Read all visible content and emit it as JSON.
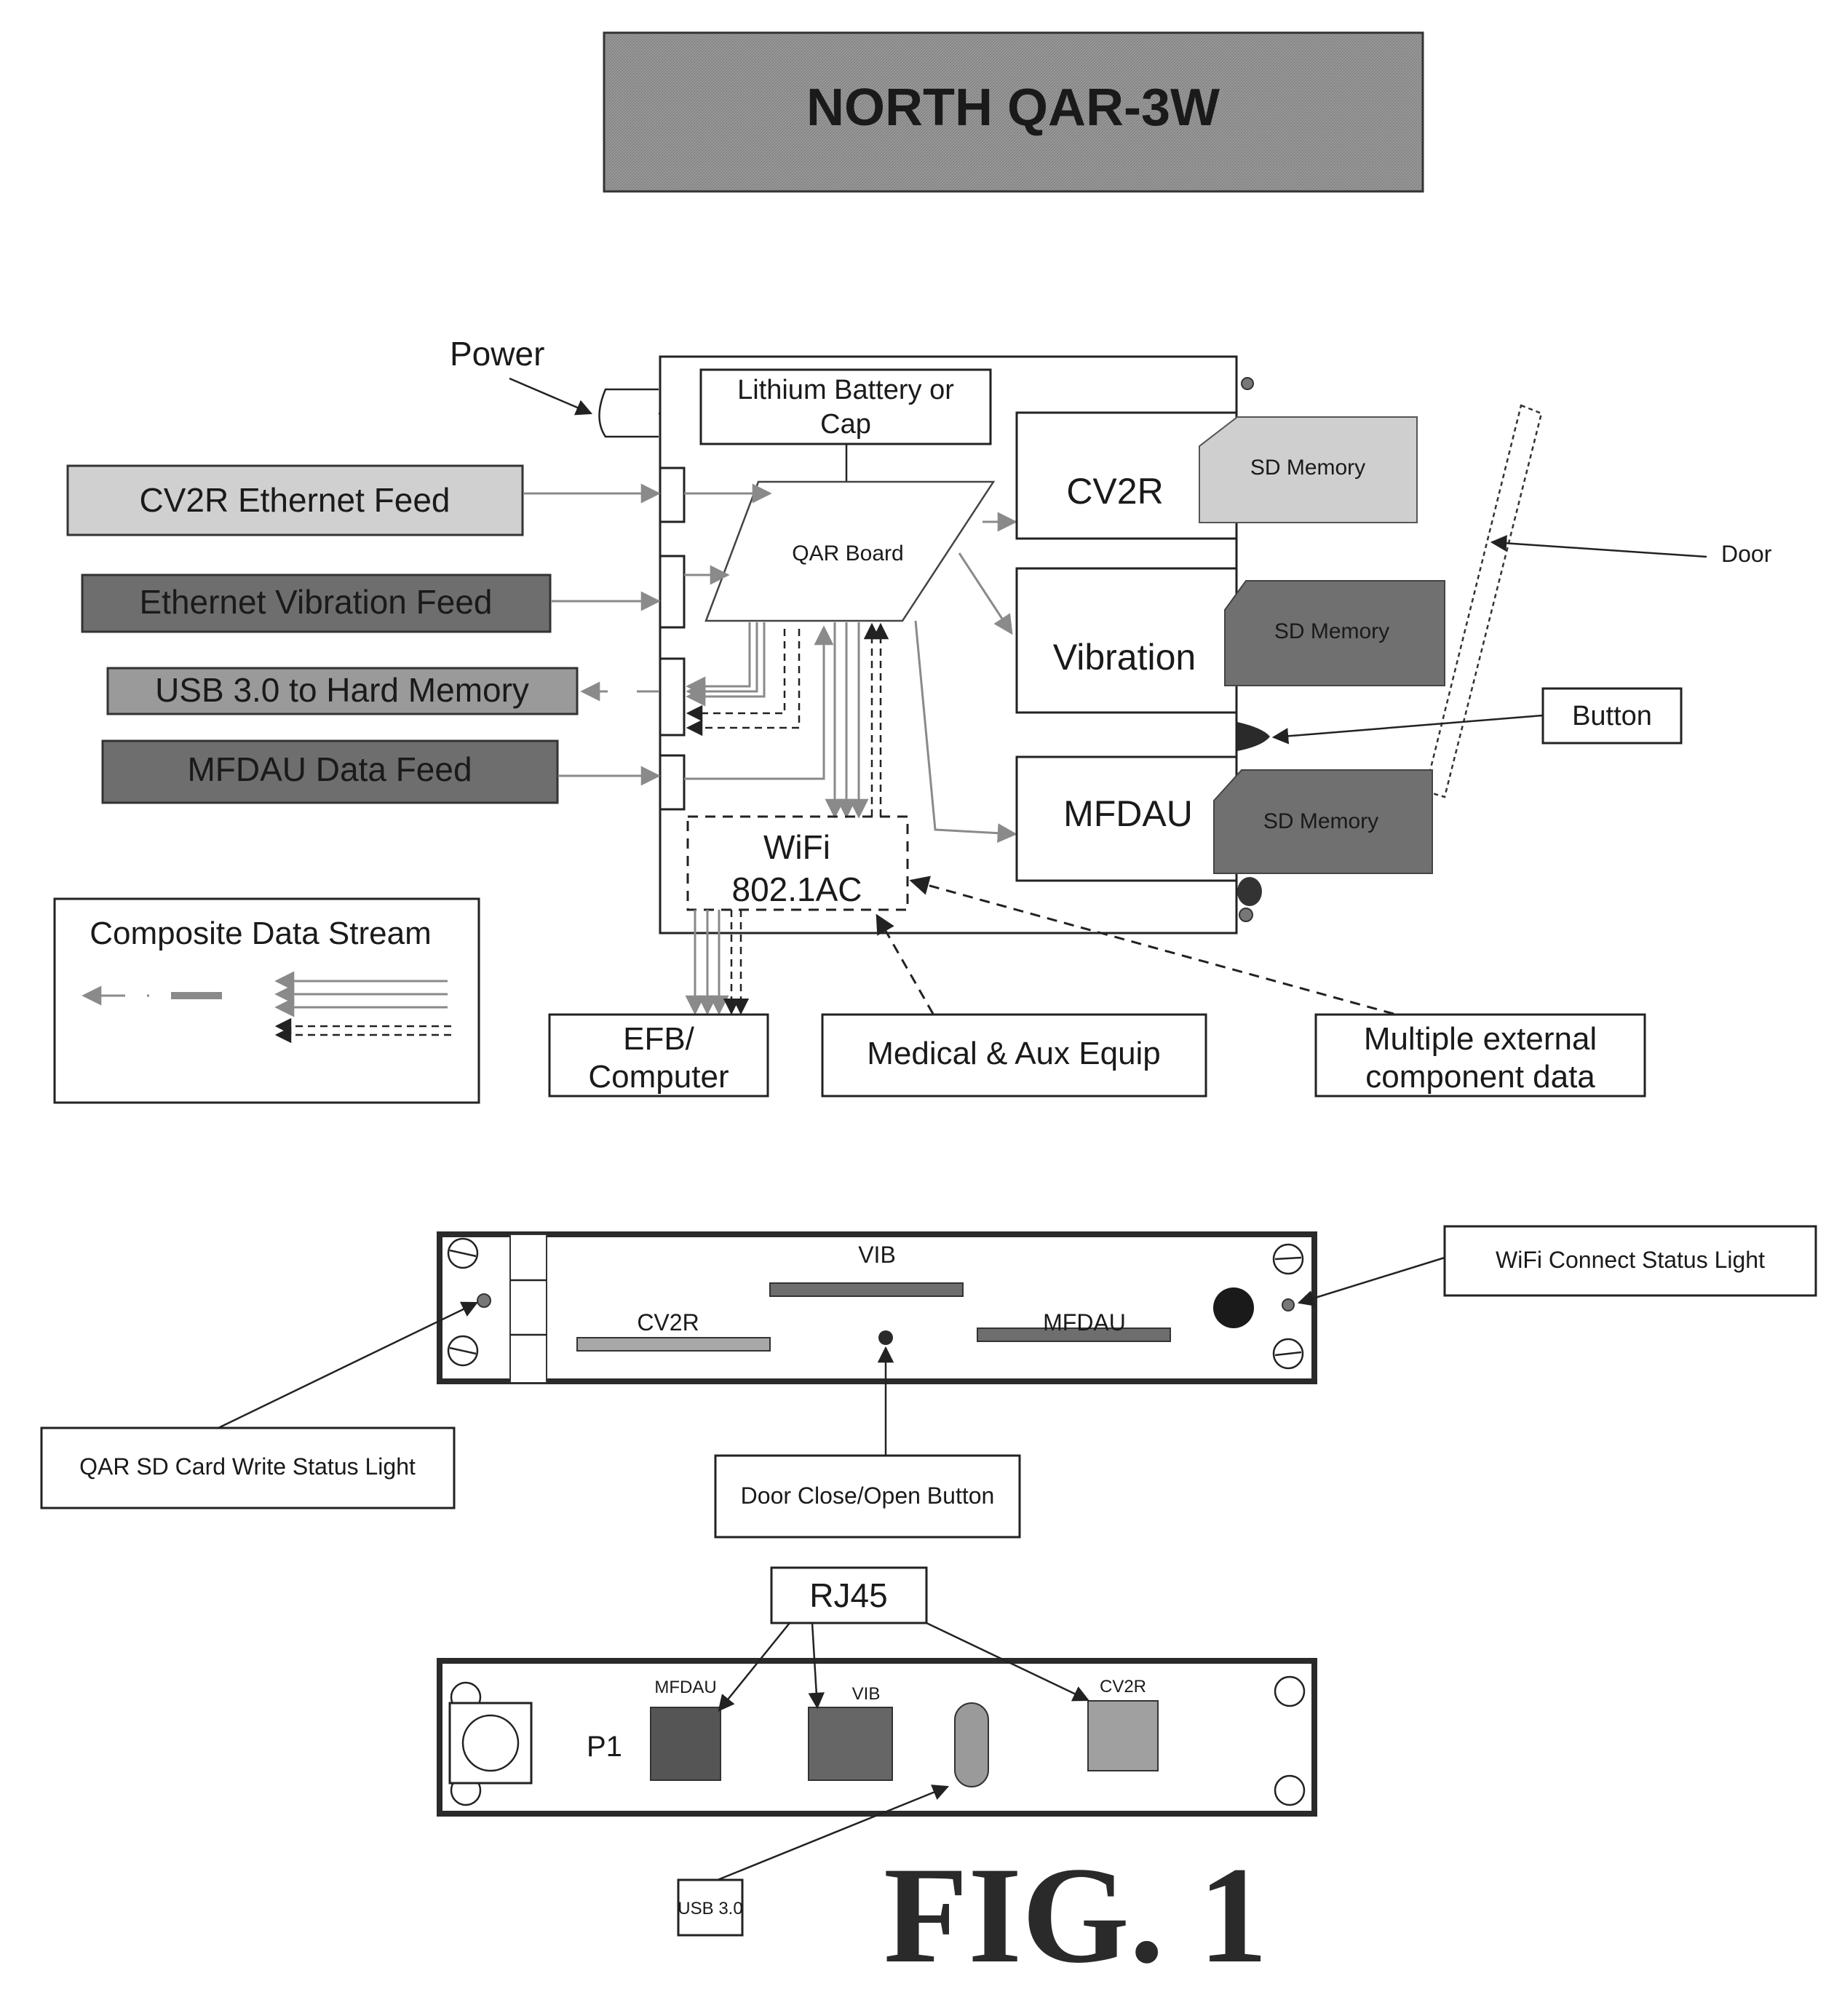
{
  "title": "NORTH QAR-3W",
  "figure_label": "FIG. 1",
  "block_diagram": {
    "power_label": "Power",
    "battery_label_line1": "Lithium Battery or",
    "battery_label_line2": "Cap",
    "qar_board_label": "QAR Board",
    "wifi_label_line1": "WiFi",
    "wifi_label_line2": "802.1AC",
    "inputs": [
      {
        "label": "CV2R Ethernet Feed",
        "fill": "#d0d0d0"
      },
      {
        "label": "Ethernet Vibration Feed",
        "fill": "#6e6e6e"
      },
      {
        "label": "USB 3.0 to Hard Memory",
        "fill": "#9a9a9a"
      },
      {
        "label": "MFDAU Data Feed",
        "fill": "#6e6e6e"
      }
    ],
    "modules": [
      {
        "label": "CV2R",
        "sd_label": "SD Memory",
        "sd_fill": "#cfcfcf"
      },
      {
        "label": "Vibration",
        "sd_label": "SD Memory",
        "sd_fill": "#707070"
      },
      {
        "label": "MFDAU",
        "sd_label": "SD Memory",
        "sd_fill": "#707070"
      }
    ],
    "door_label": "Door",
    "button_label": "Button",
    "outputs": {
      "efb_line1": "EFB/",
      "efb_line2": "Computer",
      "medical": "Medical & Aux Equip",
      "external_line1": "Multiple external",
      "external_line2": "component data"
    },
    "legend_title": "Composite Data Stream"
  },
  "front_panel": {
    "slots": [
      {
        "label": "VIB",
        "fill": "#6e6e6e"
      },
      {
        "label": "CV2R",
        "fill": "#a8a8a8"
      },
      {
        "label": "MFDAU",
        "fill": "#6e6e6e"
      }
    ],
    "callouts": {
      "wifi_light": "WiFi Connect Status Light",
      "sd_write_light": "QAR SD Card Write Status Light",
      "door_button": "Door Close/Open Button"
    }
  },
  "rear_panel": {
    "rj45_label": "RJ45",
    "p1_label": "P1",
    "ports": [
      {
        "label": "MFDAU",
        "fill": "#555555"
      },
      {
        "label": "VIB",
        "fill": "#666666"
      },
      {
        "label": "CV2R",
        "fill": "#a0a0a0"
      }
    ],
    "usb_label": "USB 3.0"
  }
}
